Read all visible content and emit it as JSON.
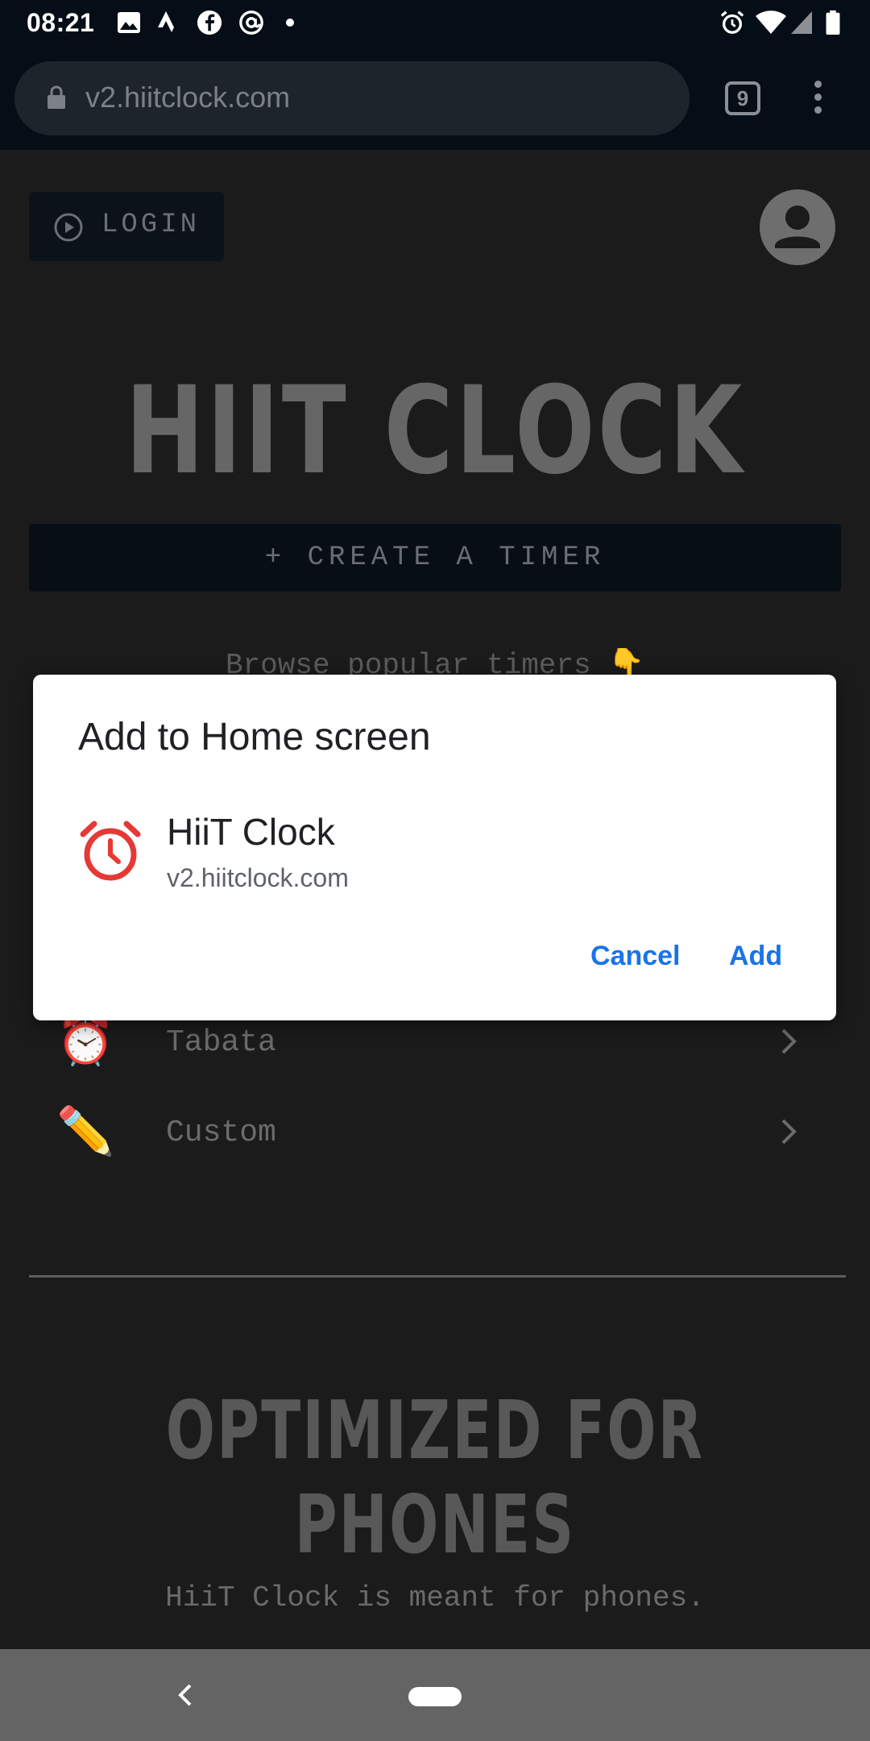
{
  "status_bar": {
    "time": "08:21",
    "left_icons": [
      "image-icon",
      "strava-icon",
      "facebook-icon",
      "at-icon",
      "dot-icon"
    ],
    "right_icons": [
      "alarm-icon",
      "wifi-icon",
      "signal-icon",
      "battery-icon"
    ]
  },
  "browser": {
    "url": "v2.hiitclock.com",
    "tab_count": "9"
  },
  "page": {
    "login_label": "LOGIN",
    "hero_title": "HIIT CLOCK",
    "create_timer_label": "+ CREATE A TIMER",
    "browse_text": "Browse popular timers 👇",
    "timers": [
      {
        "label": "Tabata",
        "emoji": "⏰"
      },
      {
        "label": "Custom",
        "emoji": "✏️"
      }
    ],
    "section_title": "OPTIMIZED FOR PHONES",
    "section_text": "HiiT Clock is meant for phones."
  },
  "dialog": {
    "title": "Add to Home screen",
    "app_name": "HiiT Clock",
    "app_url": "v2.hiitclock.com",
    "cancel_label": "Cancel",
    "add_label": "Add"
  },
  "colors": {
    "accent": "#1a73e8",
    "app_icon": "#e53935",
    "page_bg": "#1b1b1b",
    "browser_bg": "#050d16"
  }
}
